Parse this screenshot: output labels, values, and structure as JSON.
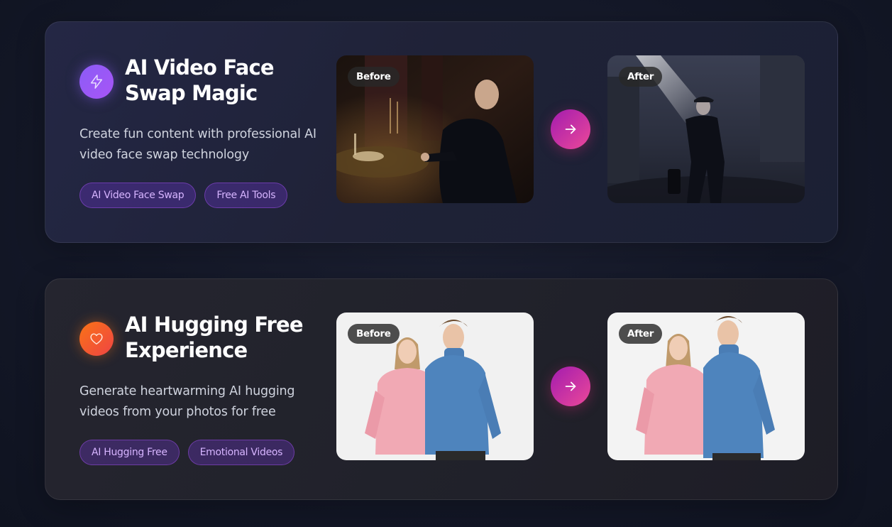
{
  "cards": [
    {
      "icon": "lightning-icon",
      "title": "AI Video Face Swap Magic",
      "description": "Create fun content with professional AI video face swap technology",
      "tags": [
        "AI Video Face Swap",
        "Free AI Tools"
      ],
      "before_label": "Before",
      "after_label": "After"
    },
    {
      "icon": "heart-icon",
      "title": "AI Hugging Free Experience",
      "description": "Generate heartwarming AI hugging videos from your photos for free",
      "tags": [
        "AI Hugging Free",
        "Emotional Videos"
      ],
      "before_label": "Before",
      "after_label": "After"
    }
  ],
  "colors": {
    "accent_purple": "#8b5cf6",
    "accent_orange": "#f97316",
    "arrow_gradient_start": "#a21caf",
    "arrow_gradient_end": "#ec4899",
    "tag_text": "#d6b4ff"
  }
}
